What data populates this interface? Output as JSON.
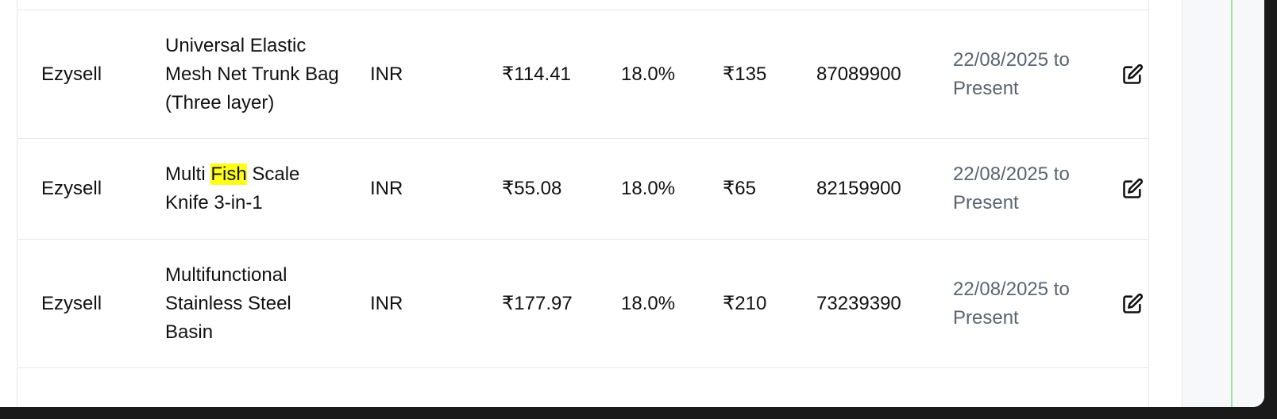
{
  "table": {
    "rows": [
      {
        "seller": "Ezysell",
        "product": "Universal Elastic Mesh Net Trunk Bag (Three layer)",
        "currency": "INR",
        "price": "₹114.41",
        "tax": "18.0%",
        "mrp": "₹135",
        "hsn": "87089900",
        "validity": "22/08/2025 to Present"
      },
      {
        "seller": "Ezysell",
        "product_pre": "Multi ",
        "product_highlight": "Fish",
        "product_post": " Scale Knife 3-in-1",
        "currency": "INR",
        "price": "₹55.08",
        "tax": "18.0%",
        "mrp": "₹65",
        "hsn": "82159900",
        "validity": "22/08/2025 to Present"
      },
      {
        "seller": "Ezysell",
        "product": "Multifunctional Stainless Steel Basin",
        "currency": "INR",
        "price": "₹177.97",
        "tax": "18.0%",
        "mrp": "₹210",
        "hsn": "73239390",
        "validity": "22/08/2025 to Present"
      }
    ]
  },
  "icons": {
    "edit": "edit-icon"
  },
  "colors": {
    "highlight": "#ffff1a",
    "accent_line": "#9be3a6",
    "muted_text": "#5b6472"
  }
}
